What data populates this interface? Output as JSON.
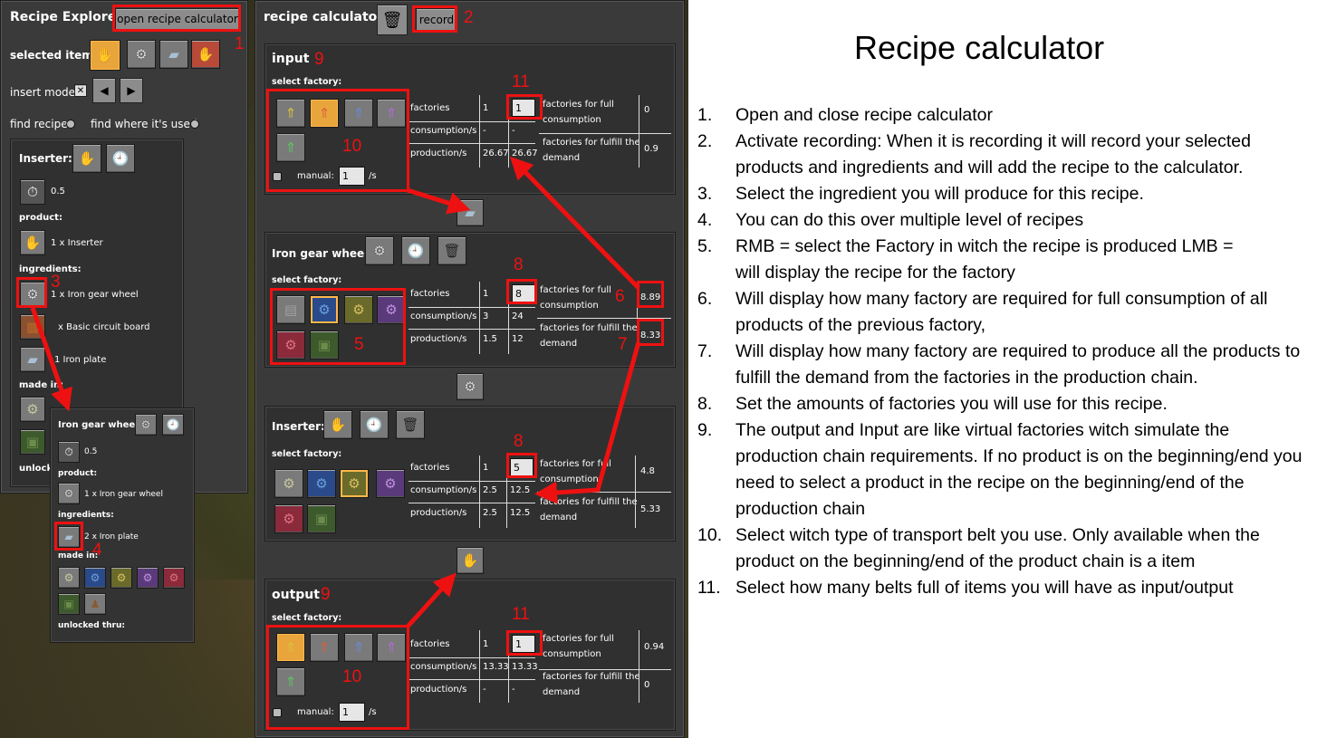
{
  "explorer": {
    "title": "Recipe Explorer",
    "open_calc": "open recipe calculator",
    "selected_item": "selected item",
    "insert_mode": "insert mode",
    "find_recipe": "find recipe",
    "find_used": "find where it's used",
    "recipe": {
      "name": "Inserter:",
      "time": "0.5",
      "product_lbl": "product:",
      "product": "1 x Inserter",
      "ingredients_lbl": "ingredients:",
      "ing1": "1 x Iron gear wheel",
      "ing2": "x Basic circuit board",
      "ing3": "1 Iron plate",
      "made_in": "made in:",
      "unlocked": "unlock"
    },
    "sub": {
      "name": "Iron gear wheel:",
      "time": "0.5",
      "product_lbl": "product:",
      "product": "1 x Iron gear wheel",
      "ingredients_lbl": "ingredients:",
      "ing1": "2 x Iron plate",
      "made_in": "made in:",
      "unlocked": "unlocked thru:"
    }
  },
  "calc": {
    "title": "recipe calculator",
    "record": "record",
    "input": {
      "title": "input",
      "select_factory": "select factory:",
      "factories": "factories",
      "factories_v": "1",
      "factories_input": "1",
      "consumption": "consumption/s",
      "cons_v1": "-",
      "cons_v2": "-",
      "production": "production/s",
      "prod_v1": "26.67",
      "prod_v2": "26.67",
      "full": "factories for full consumption",
      "full_v": "0",
      "fulfill": "factories for fulfill the demand",
      "fulfill_v": "0.9",
      "manual": "manual:",
      "manual_v": "1",
      "unit": "/s"
    },
    "gear": {
      "title": "Iron gear wheel:",
      "select_factory": "select factory:",
      "factories": "factories",
      "factories_v": "1",
      "factories_input": "8",
      "consumption": "consumption/s",
      "cons_v1": "3",
      "cons_v2": "24",
      "production": "production/s",
      "prod_v1": "1.5",
      "prod_v2": "12",
      "full": "factories for full consumption",
      "full_v": "8.89",
      "fulfill": "factories for fulfill the demand",
      "fulfill_v": "8.33"
    },
    "inserter": {
      "title": "Inserter:",
      "select_factory": "select factory:",
      "factories": "factories",
      "factories_v": "1",
      "factories_input": "5",
      "consumption": "consumption/s",
      "cons_v1": "2.5",
      "cons_v2": "12.5",
      "production": "production/s",
      "prod_v1": "2.5",
      "prod_v2": "12.5",
      "full": "factories for full consumption",
      "full_v": "4.8",
      "fulfill": "factories for fulfill the demand",
      "fulfill_v": "5.33"
    },
    "output": {
      "title": "output",
      "select_factory": "select factory:",
      "factories": "factories",
      "factories_v": "1",
      "factories_input": "1",
      "consumption": "consumption/s",
      "cons_v1": "13.33",
      "cons_v2": "13.33",
      "production": "production/s",
      "prod_v1": "-",
      "prod_v2": "-",
      "full": "factories for full consumption",
      "full_v": "0.94",
      "fulfill": "factories for fulfill the demand",
      "fulfill_v": "0",
      "manual": "manual:",
      "manual_v": "1",
      "unit": "/s"
    }
  },
  "markers": [
    "1",
    "2",
    "3",
    "4",
    "5",
    "6",
    "7",
    "8",
    "9",
    "10",
    "11"
  ],
  "doc": {
    "title": "Recipe calculator",
    "steps": [
      {
        "n": "1.",
        "t": "Open and close recipe calculator"
      },
      {
        "n": "2.",
        "t": "Activate recording: When it is recording it will record your selected products and ingredients and will add the recipe to the calculator."
      },
      {
        "n": "3.",
        "t": "Select the ingredient you will produce for this recipe."
      },
      {
        "n": "4.",
        "t": "You can do this over multiple level of recipes"
      },
      {
        "n": "5.",
        "t": "RMB = select the Factory in witch the recipe is produced LMB = will display the recipe for the factory"
      },
      {
        "n": "6.",
        "t": "Will display how many factory are required for full consumption of all products of the previous factory,"
      },
      {
        "n": "7.",
        "t": "Will display how many factory are required to produce all the products to fulfill the demand from the factories in the production chain."
      },
      {
        "n": "8.",
        "t": "Set the amounts of factories you will use for this recipe."
      },
      {
        "n": "9.",
        "t": "The output and Input are like virtual factories witch simulate the production chain requirements. If no product is on the beginning/end you need to select a product in the recipe on the beginning/end of the production chain"
      },
      {
        "n": "10.",
        "t": "Select witch type of transport belt you use. Only available when the product on the beginning/end of the product chain is a item"
      },
      {
        "n": "11.",
        "t": "Select how many belts full of items you will have as input/output"
      }
    ]
  },
  "colors": {
    "accent": "#e11111",
    "selected": "#e8a53c",
    "panel": "#3a3a3a"
  }
}
